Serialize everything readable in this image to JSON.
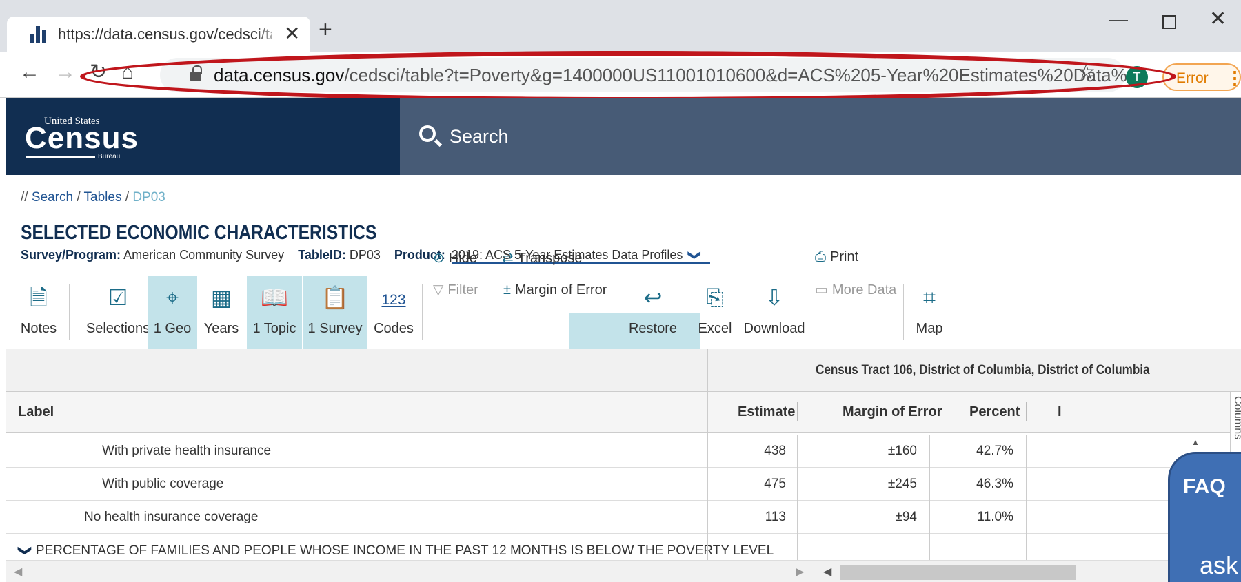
{
  "browser": {
    "tab_title": "https://data.census.gov/cedsci/ta",
    "tab_close": "✕",
    "new_tab": "+",
    "url_host": "data.census.gov",
    "url_path": "/cedsci/table?t=Poverty&g=1400000US11001010600&d=ACS%205-Year%20Estimates%20Data%...",
    "profile_initial": "T",
    "error_label": "Error",
    "menu_glyph": "⋮",
    "nav": {
      "back": "←",
      "forward": "→",
      "reload": "↻",
      "home": "⌂",
      "star": "☆"
    },
    "window": {
      "minimize": "—",
      "close": "✕"
    },
    "accent_color": "#c0161c"
  },
  "header": {
    "logo_small": "United States",
    "logo_main": "Census",
    "logo_bureau": "Bureau",
    "search_label": "Search"
  },
  "breadcrumb": {
    "prefix": "//",
    "items": [
      "Search",
      "Tables",
      "DP03"
    ],
    "sep": "/"
  },
  "table_info": {
    "title": "SELECTED ECONOMIC CHARACTERISTICS",
    "survey_label": "Survey/Program:",
    "survey_value": "American Community Survey",
    "tableid_label": "TableID:",
    "tableid_value": "DP03",
    "product_label": "Product:",
    "product_value": "2019: ACS 5-Year Estimates Data Profiles",
    "product_chevron": "❯"
  },
  "ribbon": {
    "notes": "Notes",
    "selections": "Selections",
    "geo": "1 Geo",
    "years": "Years",
    "topic": "1 Topic",
    "survey": "1 Survey",
    "codes": "Codes",
    "codes_num": "123",
    "hide": "Hide",
    "filter": "Filter",
    "transpose": "Transpose",
    "moe": "Margin of Error",
    "restore": "Restore",
    "excel": "Excel",
    "download": "Download",
    "print": "Print",
    "more_data": "More Data",
    "map": "Map"
  },
  "table": {
    "group_header": "Census Tract 106, District of Columbia, District of Columbia",
    "col_label": "Label",
    "col_estimate": "Estimate",
    "col_moe": "Margin of Error",
    "col_percent": "Percent",
    "col_cut": "I",
    "columns_tab": "Columns",
    "rows": [
      {
        "label": "With private health insurance",
        "estimate": "438",
        "moe": "±160",
        "percent": "42.7%"
      },
      {
        "label": "With public coverage",
        "estimate": "475",
        "moe": "±245",
        "percent": "46.3%"
      },
      {
        "label": "No health insurance coverage",
        "estimate": "113",
        "moe": "±94",
        "percent": "11.0%"
      }
    ],
    "section_row": "PERCENTAGE OF FAMILIES AND PEOPLE WHOSE INCOME IN THE PAST 12 MONTHS IS BELOW THE POVERTY LEVEL",
    "section_chevron": "❯"
  },
  "callout": {
    "faq": "FAQ",
    "partial": "ask"
  }
}
